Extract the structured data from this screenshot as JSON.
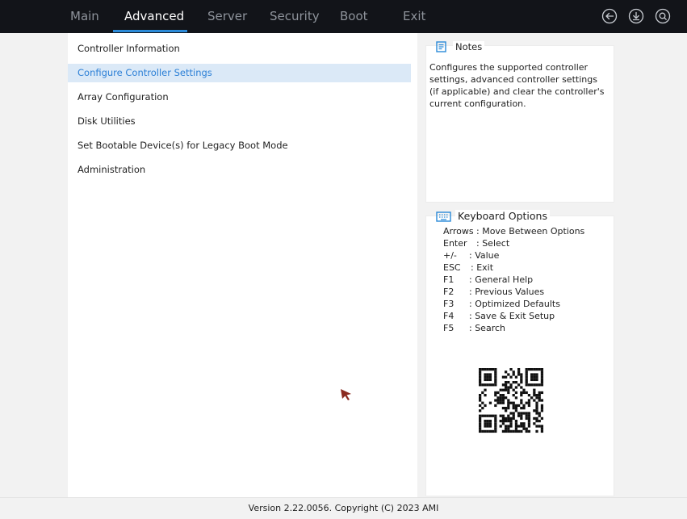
{
  "tabs": [
    {
      "label": "Main"
    },
    {
      "label": "Advanced",
      "active": true
    },
    {
      "label": "Server"
    },
    {
      "label": "Security"
    },
    {
      "label": "Boot"
    },
    {
      "label": "Exit"
    }
  ],
  "top_icons": [
    "back-icon",
    "download-icon",
    "search-icon"
  ],
  "menu": {
    "items": [
      {
        "label": "Controller Information"
      },
      {
        "label": "Configure Controller Settings",
        "selected": true
      },
      {
        "label": "Array Configuration"
      },
      {
        "label": "Disk Utilities"
      },
      {
        "label": "Set Bootable Device(s) for Legacy Boot Mode"
      },
      {
        "label": "Administration"
      }
    ]
  },
  "notes": {
    "title": "Notes",
    "text": "Configures the supported controller settings, advanced controller settings (if applicable) and clear the controller's current configuration."
  },
  "keyboard": {
    "title": "Keyboard Options",
    "rows": [
      {
        "key": "Arrows",
        "desc": ": Move Between Options"
      },
      {
        "key": "Enter",
        "desc": ": Select"
      },
      {
        "key": "+/-",
        "desc": ": Value"
      },
      {
        "key": "ESC",
        "desc": ": Exit"
      },
      {
        "key": "F1",
        "desc": ": General Help"
      },
      {
        "key": "F2",
        "desc": ": Previous Values"
      },
      {
        "key": "F3",
        "desc": ": Optimized Defaults"
      },
      {
        "key": "F4",
        "desc": ": Save & Exit Setup"
      },
      {
        "key": "F5",
        "desc": ": Search"
      }
    ]
  },
  "footer": {
    "text": "Version 2.22.0056. Copyright (C) 2023 AMI"
  },
  "colors": {
    "topbar": "#121419",
    "accent": "#2b8ad8",
    "selected_bg": "#dbe9f7",
    "selected_text": "#2b7fd6",
    "cursor": "#8b2a1f"
  }
}
